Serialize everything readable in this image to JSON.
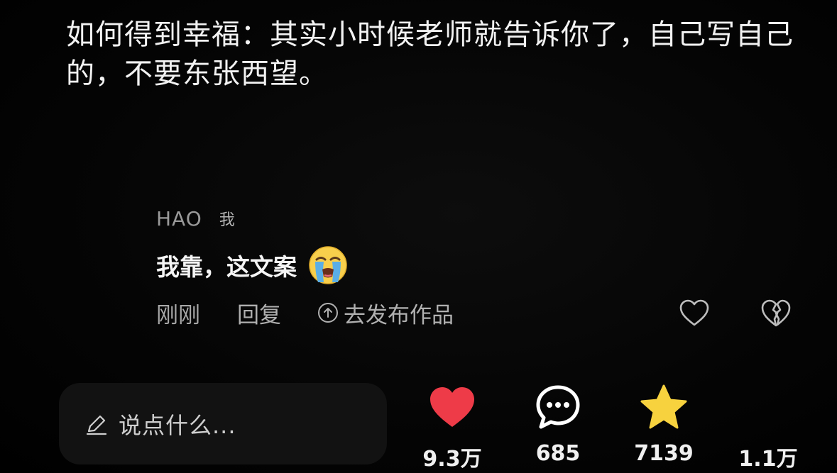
{
  "video": {
    "caption": "如何得到幸福：其实小时候老师就告诉你了，自己写自己的，不要东张西望。"
  },
  "comment": {
    "username": "HAO",
    "author_tag": "我",
    "text": "我靠，这文案",
    "emoji": "loudly-crying-face",
    "time": "刚刚",
    "reply_label": "回复",
    "publish_label": "去发布作品"
  },
  "bottom_bar": {
    "input_placeholder": "说点什么...",
    "likes": "9.3万",
    "comments": "685",
    "favorites": "7139",
    "shares": "1.1万"
  },
  "colors": {
    "like_red": "#ee3b48",
    "star_yellow": "#f7d23e",
    "emoji_blue": "#5aaee6"
  }
}
